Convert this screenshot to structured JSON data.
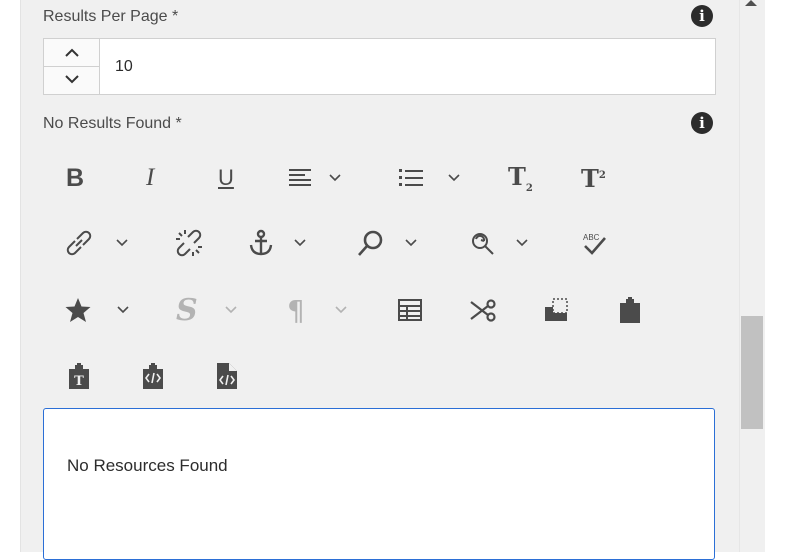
{
  "results_per_page": {
    "label": "Results Per Page *",
    "value": "10"
  },
  "no_results_found": {
    "label": "No Results Found *"
  },
  "toolbar": {
    "row1": [
      "bold",
      "italic",
      "underline",
      "align",
      "list",
      "subscript",
      "superscript"
    ],
    "row2": [
      "link",
      "unlink",
      "anchor",
      "find",
      "replace",
      "spellcheck"
    ],
    "row3": [
      "special-characters",
      "styles",
      "paragraph",
      "table",
      "cut",
      "copy",
      "paste"
    ],
    "row4": [
      "paste-as-text",
      "paste-from-word",
      "source-edit"
    ]
  },
  "editor": {
    "content": "No Resources Found"
  },
  "colors": {
    "accent": "#2b6fd6",
    "panel": "#f0f0f0",
    "icon": "#4b4b4b",
    "disabled": "#b3b3b3"
  }
}
